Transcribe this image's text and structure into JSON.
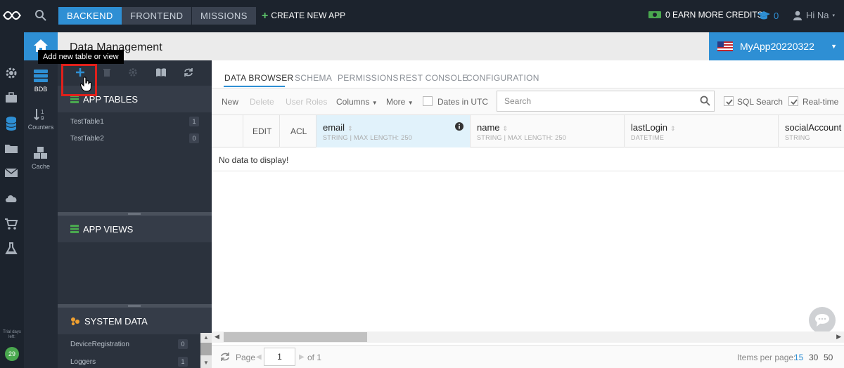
{
  "topbar": {
    "nav": [
      {
        "label": "BACKEND",
        "active": true
      },
      {
        "label": "FRONTEND",
        "active": false
      },
      {
        "label": "MISSIONS",
        "active": false
      }
    ],
    "create_app": "CREATE NEW APP",
    "credits": "0 EARN MORE CREDITS",
    "grad_count": "0",
    "user": "Hi Na"
  },
  "trial": {
    "label": "Trial days left:",
    "days": "29"
  },
  "subbar": {
    "items": [
      {
        "label": "BDB"
      },
      {
        "label": "Counters"
      },
      {
        "label": "Cache"
      }
    ]
  },
  "tooltip": "Add new table or view",
  "title": "Data Management",
  "app_select": "MyApp20220322",
  "panel": {
    "app_tables": {
      "heading": "APP TABLES",
      "items": [
        {
          "name": "TestTable1",
          "count": "1"
        },
        {
          "name": "TestTable2",
          "count": "0"
        }
      ]
    },
    "app_views": {
      "heading": "APP VIEWS"
    },
    "system_data": {
      "heading": "SYSTEM DATA",
      "items": [
        {
          "name": "DeviceRegistration",
          "count": "0"
        },
        {
          "name": "Loggers",
          "count": "1"
        }
      ]
    }
  },
  "tabs": [
    "DATA BROWSER",
    "SCHEMA",
    "PERMISSIONS",
    "REST CONSOLE",
    "CONFIGURATION"
  ],
  "toolbar": {
    "new": "New",
    "delete": "Delete",
    "user_roles": "User Roles",
    "columns": "Columns",
    "more": "More",
    "dates_utc": "Dates in UTC",
    "search_placeholder": "Search",
    "sql_search": "SQL Search",
    "realtime": "Real-time"
  },
  "grid": {
    "edit": "EDIT",
    "acl": "ACL",
    "columns": [
      {
        "name": "email",
        "type": "STRING | MAX LENGTH: 250"
      },
      {
        "name": "name",
        "type": "STRING | MAX LENGTH: 250"
      },
      {
        "name": "lastLogin",
        "type": "DATETIME"
      },
      {
        "name": "socialAccount",
        "type": "STRING"
      }
    ],
    "empty": "No data to display!"
  },
  "footer": {
    "page_label": "Page",
    "page_value": "1",
    "of": "of 1",
    "items_label": "Items per page:",
    "options": [
      "15",
      "30",
      "50"
    ]
  },
  "colors": {
    "accent": "#2e8fd4",
    "dark": "#1c232d",
    "highlight": "#e0201b"
  }
}
